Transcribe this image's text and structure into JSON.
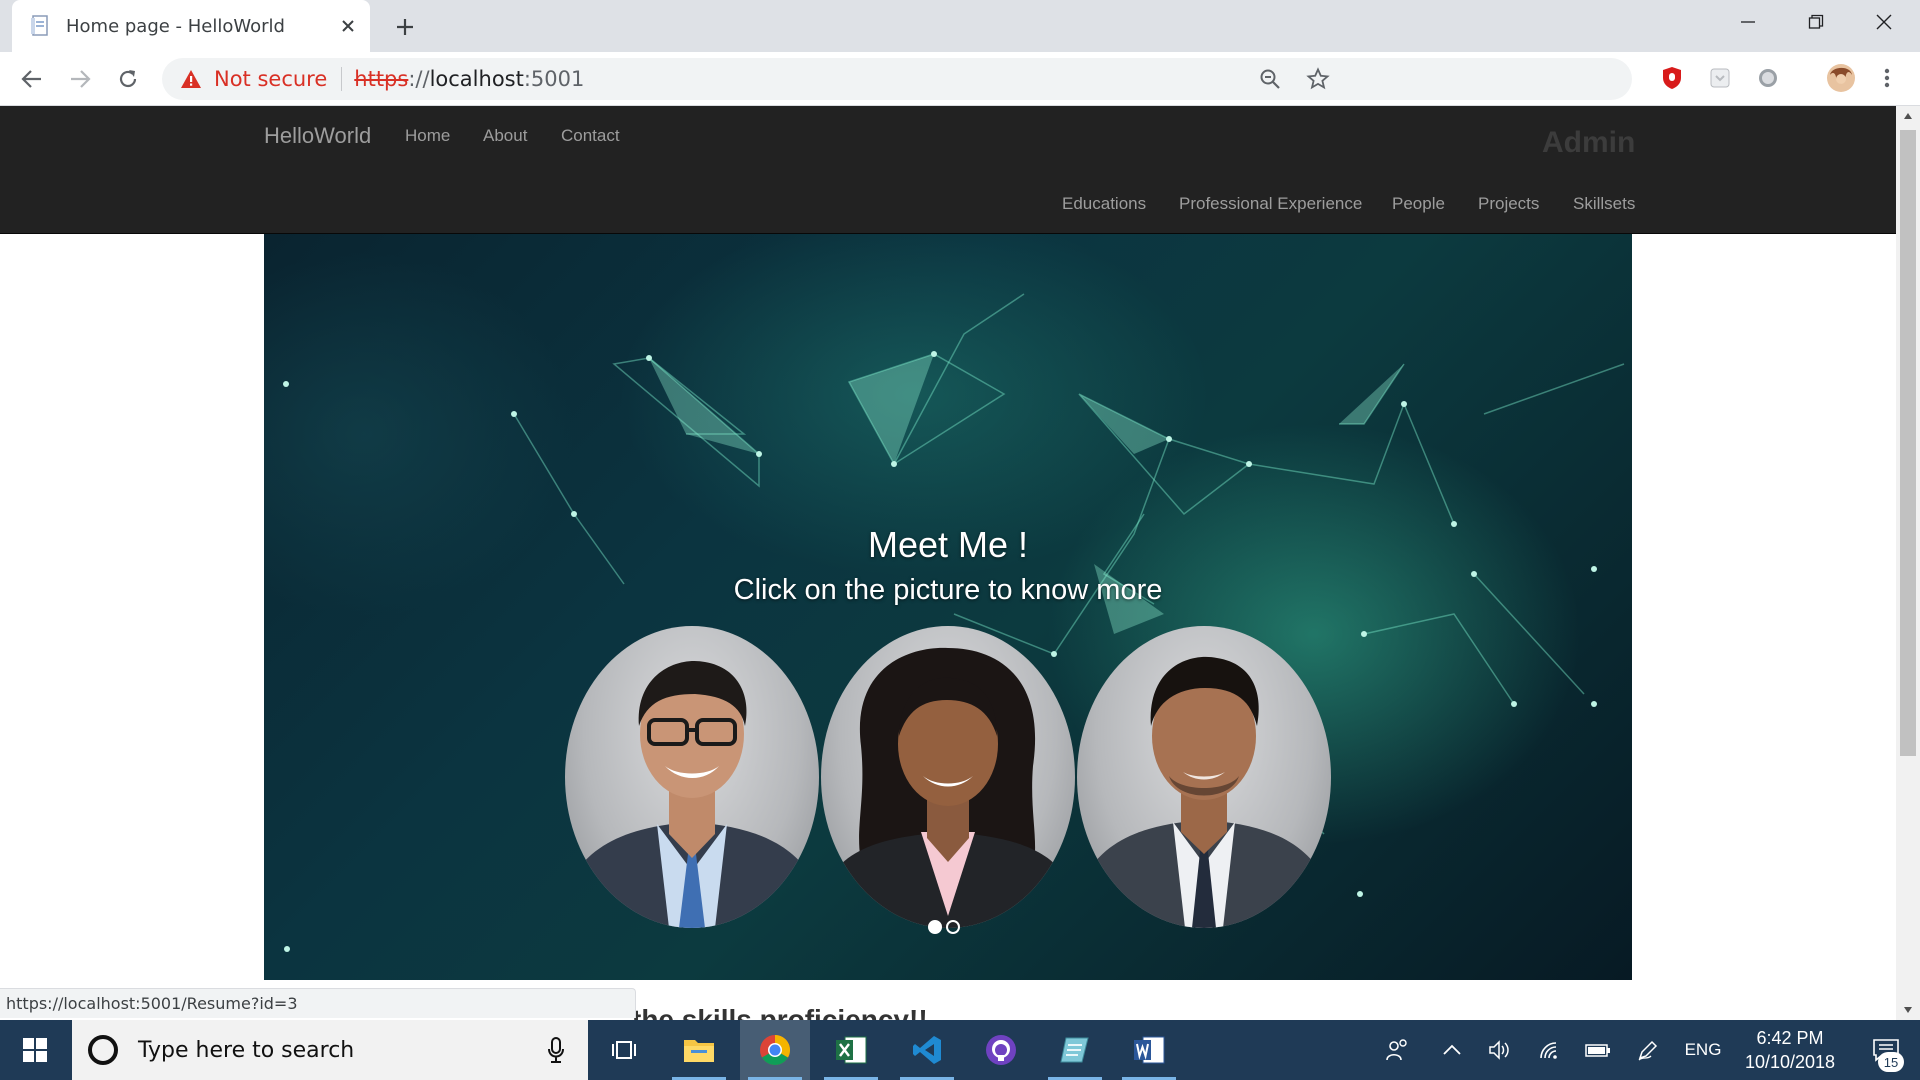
{
  "browser": {
    "tab_title": "Home page - HelloWorld",
    "security_label": "Not secure",
    "url_scheme": "https",
    "url_sep": "://",
    "url_host": "localhost",
    "url_port": ":5001",
    "status_url": "https://localhost:5001/Resume?id=3"
  },
  "site": {
    "brand": "HelloWorld",
    "top_nav": [
      "Home",
      "About",
      "Contact"
    ],
    "admin_label": "Admin",
    "admin_nav": [
      "Educations",
      "Professional Experience",
      "People",
      "Projects",
      "Skillsets"
    ]
  },
  "hero": {
    "title": "Meet Me !",
    "subtitle": "Click on the picture to know more",
    "slides_total": 2,
    "active_slide": 1
  },
  "below_text": "the skills proficiency!!",
  "taskbar": {
    "search_placeholder": "Type here to search",
    "language": "ENG",
    "time": "6:42 PM",
    "date": "10/10/2018",
    "notification_count": "15",
    "apps": [
      "task-view",
      "file-explorer",
      "chrome",
      "excel",
      "vscode",
      "github-desktop",
      "notepad",
      "word"
    ],
    "active_app": "chrome"
  },
  "colors": {
    "nav_bg": "#222222",
    "nav_text": "#9d9d9d",
    "not_secure_red": "#d93025",
    "taskbar_bg": "#1f3a56"
  }
}
